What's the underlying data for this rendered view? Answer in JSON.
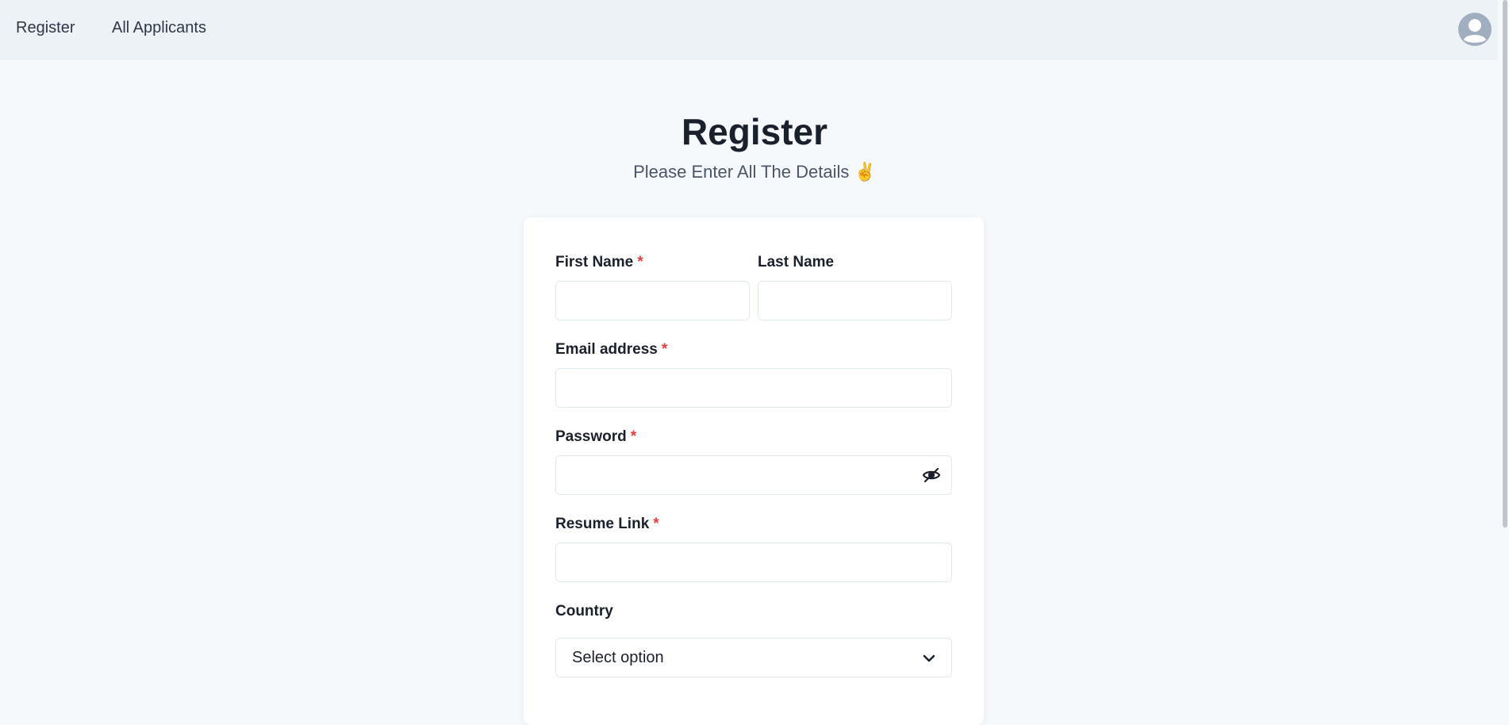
{
  "nav": {
    "register_label": "Register",
    "applicants_label": "All Applicants"
  },
  "page": {
    "title": "Register",
    "subtitle": "Please Enter All The Details ✌️"
  },
  "form": {
    "first_name": {
      "label": "First Name",
      "required": "*",
      "value": "",
      "placeholder": ""
    },
    "last_name": {
      "label": "Last Name",
      "value": "",
      "placeholder": ""
    },
    "email": {
      "label": "Email address",
      "required": "*",
      "value": "",
      "placeholder": ""
    },
    "password": {
      "label": "Password",
      "required": "*",
      "value": "",
      "placeholder": ""
    },
    "resume": {
      "label": "Resume Link",
      "required": "*",
      "value": "",
      "placeholder": ""
    },
    "country": {
      "label": "Country",
      "selected": "Select option"
    }
  },
  "icons": {
    "avatar": "user-avatar-icon",
    "password_toggle": "eye-slash-icon",
    "select_chevron": "chevron-down-icon"
  },
  "colors": {
    "required": "#e53e3e",
    "navbar_bg": "#edf2f7",
    "page_bg": "#f6f9fc",
    "avatar": "#a0aec0"
  }
}
